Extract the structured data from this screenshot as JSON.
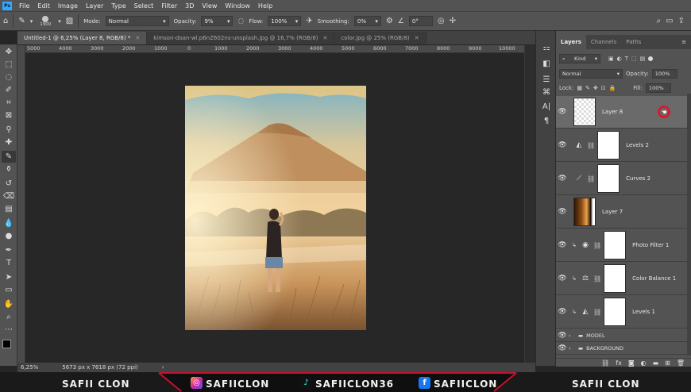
{
  "menubar": {
    "app_badge": "Ps",
    "items": [
      "File",
      "Edit",
      "Image",
      "Layer",
      "Type",
      "Select",
      "Filter",
      "3D",
      "View",
      "Window",
      "Help"
    ]
  },
  "options": {
    "brush_size": "1900",
    "mode_label": "Mode:",
    "mode_value": "Normal",
    "opacity_label": "Opacity:",
    "opacity_value": "9%",
    "flow_label": "Flow:",
    "flow_value": "100%",
    "smoothing_label": "Smoothing:",
    "smoothing_value": "0%",
    "angle_value": "0°"
  },
  "tabs": [
    {
      "label": "Untitled-1 @ 6,25% (Layer 8, RGB/8) *"
    },
    {
      "label": "kimson-doan-wl.p6nZ602ns-unsplash.jpg @ 16,7% (RGB/8)"
    },
    {
      "label": "color.jpg @ 25% (RGB/8)"
    }
  ],
  "ruler": [
    "5000",
    "4000",
    "3000",
    "2000",
    "1000",
    "0",
    "1000",
    "2000",
    "3000",
    "4000",
    "5000",
    "6000",
    "7000",
    "8000",
    "9000",
    "10000"
  ],
  "status": {
    "zoom": "6,25%",
    "doc_size": "5673 px x 7618 px (72 ppi)"
  },
  "panel": {
    "tabs": [
      "Layers",
      "Channels",
      "Paths"
    ],
    "filter_kind": "Kind",
    "blend_mode": "Normal",
    "opacity_label": "Opacity:",
    "opacity_value": "100%",
    "lock_label": "Lock:",
    "fill_label": "Fill:",
    "fill_value": "100%"
  },
  "layers": [
    {
      "name": "Layer 8"
    },
    {
      "name": "Levels 2"
    },
    {
      "name": "Curves 2"
    },
    {
      "name": "Layer 7"
    },
    {
      "name": "Photo Filter 1"
    },
    {
      "name": "Color Balance 1"
    },
    {
      "name": "Levels 1"
    }
  ],
  "groups": [
    {
      "name": "MODEL"
    },
    {
      "name": "BACKGROUND"
    }
  ],
  "banner": {
    "left": "SAFII CLON",
    "instagram": "SAFIICLON",
    "tiktok": "SAFIICLON36",
    "facebook": "SAFIICLON",
    "right": "SAFII CLON"
  },
  "colors": {
    "accent_red": "#c8102e",
    "ps_blue": "#31a8ff",
    "panel_bg": "#535353",
    "canvas_bg": "#272727"
  }
}
